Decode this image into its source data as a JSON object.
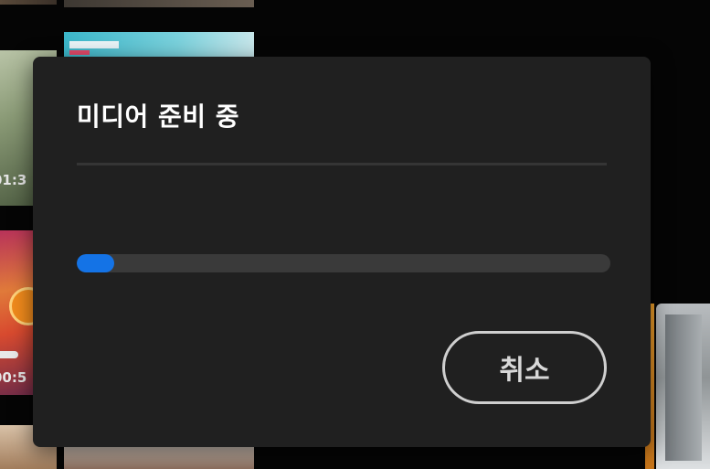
{
  "background": {
    "durations": [
      "01:3",
      "00:5"
    ]
  },
  "dialog": {
    "title": "미디어 준비 중",
    "progress_percent": 7,
    "cancel_label": "취소"
  },
  "colors": {
    "dialog_bg": "#202020",
    "progress_fill": "#1473e6",
    "progress_track": "#3a3a3a",
    "page_bg": "#050505"
  }
}
